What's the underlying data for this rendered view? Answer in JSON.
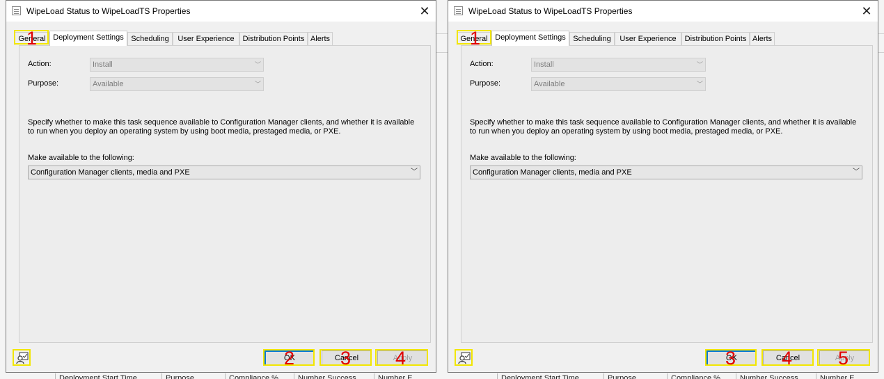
{
  "dialogs": [
    {
      "title": "WipeLoad Status to WipeLoadTS Properties",
      "tabs": [
        {
          "label": "General"
        },
        {
          "label": "Deployment Settings"
        },
        {
          "label": "Scheduling"
        },
        {
          "label": "User Experience"
        },
        {
          "label": "Distribution Points"
        },
        {
          "label": "Alerts"
        }
      ],
      "active_tab": "Deployment Settings",
      "action_label": "Action:",
      "action_value": "Install",
      "purpose_label": "Purpose:",
      "purpose_value": "Available",
      "description": "Specify whether to make this task sequence available to Configuration Manager clients, and whether it is available to run when you deploy an operating system by using boot media, prestaged media, or PXE.",
      "make_available_label": "Make available to the following:",
      "make_available_value": "Configuration Manager clients, media and PXE",
      "ok_label": "OK",
      "cancel_label": "Cancel",
      "apply_label": "Apply",
      "markers": {
        "general": "1",
        "ok": "2",
        "cancel": "3",
        "apply": "4"
      }
    },
    {
      "title": "WipeLoad Status to WipeLoadTS Properties",
      "tabs": [
        {
          "label": "General"
        },
        {
          "label": "Deployment Settings"
        },
        {
          "label": "Scheduling"
        },
        {
          "label": "User Experience"
        },
        {
          "label": "Distribution Points"
        },
        {
          "label": "Alerts"
        }
      ],
      "active_tab": "Deployment Settings",
      "action_label": "Action:",
      "action_value": "Install",
      "purpose_label": "Purpose:",
      "purpose_value": "Available",
      "description": "Specify whether to make this task sequence available to Configuration Manager clients, and whether it is available to run when you deploy an operating system by using boot media, prestaged media, or PXE.",
      "make_available_label": "Make available to the following:",
      "make_available_value": "Configuration Manager clients, media and PXE",
      "ok_label": "OK",
      "cancel_label": "Cancel",
      "apply_label": "Apply",
      "markers": {
        "general": "1",
        "ok": "3",
        "cancel": "4",
        "apply": "5"
      }
    }
  ],
  "background_columns": [
    "Deployment Start Time",
    "Purpose",
    "Compliance %",
    "Number Success",
    "Number E"
  ],
  "colors": {
    "highlight": "#f2e600",
    "marker": "#e00000",
    "default_button_border": "#0078d7"
  }
}
